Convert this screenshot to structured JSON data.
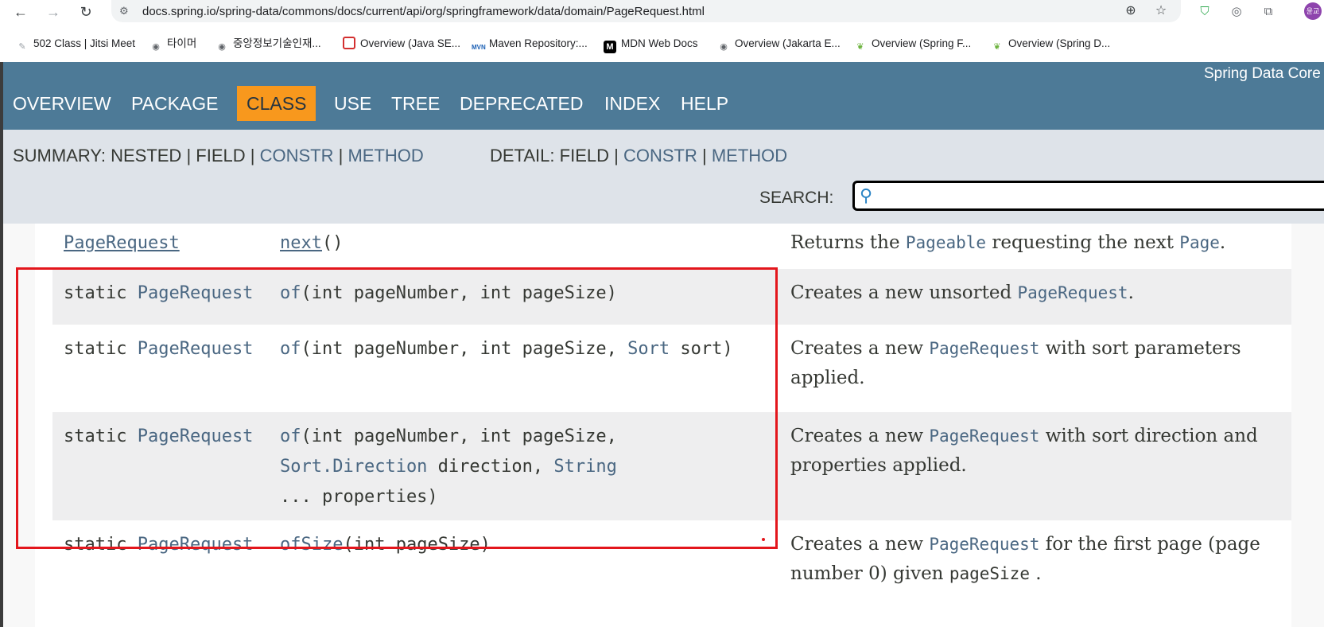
{
  "browser": {
    "url": "docs.spring.io/spring-data/commons/docs/current/api/org/springframework/data/domain/PageRequest.html",
    "bookmarks": [
      {
        "label": "502 Class | Jitsi Meet",
        "icon": "jitsi-icon"
      },
      {
        "label": "타이머",
        "icon": "globe-icon"
      },
      {
        "label": "중앙정보기술인재...",
        "icon": "globe-icon"
      },
      {
        "label": "Overview (Java SE...",
        "icon": "oracle-icon"
      },
      {
        "label": "Maven Repository:...",
        "icon": "maven-icon"
      },
      {
        "label": "MDN Web Docs",
        "icon": "mdn-icon"
      },
      {
        "label": "Overview (Jakarta E...",
        "icon": "globe-icon"
      },
      {
        "label": "Overview (Spring F...",
        "icon": "spring-icon"
      },
      {
        "label": "Overview (Spring D...",
        "icon": "spring-icon"
      }
    ],
    "avatar_text": "윤교"
  },
  "javadoc": {
    "nav": [
      "OVERVIEW",
      "PACKAGE",
      "CLASS",
      "USE",
      "TREE",
      "DEPRECATED",
      "INDEX",
      "HELP"
    ],
    "active_nav": "CLASS",
    "about": "Spring Data Core",
    "summary": {
      "label": "SUMMARY:",
      "nested": "NESTED",
      "field": "FIELD",
      "constr": "CONSTR",
      "method": "METHOD",
      "sep": "|"
    },
    "detail": {
      "label": "DETAIL:",
      "field": "FIELD",
      "constr": "CONSTR",
      "method": "METHOD"
    },
    "search_label": "SEARCH:",
    "search_value": ""
  },
  "methods": {
    "r0": {
      "type": "PageRequest",
      "name": "next",
      "args": "()",
      "desc_a": "Returns the ",
      "desc_link1": "Pageable",
      "desc_b": " requesting the next ",
      "desc_link2": "Page",
      "desc_c": "."
    },
    "r1": {
      "mod": "static",
      "type": "PageRequest",
      "name": "of",
      "args": "(int pageNumber, int pageSize)",
      "desc_a": "Creates a new unsorted ",
      "desc_link": "PageRequest",
      "desc_b": "."
    },
    "r2": {
      "mod": "static",
      "type": "PageRequest",
      "name": "of",
      "args_a": "(int pageNumber, int pageSize, ",
      "sort": "Sort",
      "args_b": " sort)",
      "desc_a": "Creates a new ",
      "desc_link": "PageRequest",
      "desc_b": " with sort parameters applied."
    },
    "r3": {
      "mod": "static",
      "type": "PageRequest",
      "name": "of",
      "line1": "(int pageNumber, int pageSize,",
      "direction_type": "Sort.Direction",
      "direction_arg": " direction, ",
      "string_type": "String",
      "line3": "... properties)",
      "desc_a": "Creates a new ",
      "desc_link": "PageRequest",
      "desc_b": " with sort direction and properties applied."
    },
    "r4": {
      "mod": "static",
      "type": "PageRequest",
      "name": "ofSize",
      "args": "(int pageSize)",
      "desc_a": "Creates a new ",
      "desc_link": "PageRequest",
      "desc_b": " for the first page (page number ",
      "desc_code1": "0",
      "desc_c": ") given ",
      "desc_code2": "pageSize",
      "desc_d": " ."
    }
  },
  "colors": {
    "nav_bg": "#4d7a97",
    "active_tab": "#f8981d",
    "subnav_bg": "#dee3e9",
    "link": "#4a6782",
    "highlight": "#e3161c"
  }
}
